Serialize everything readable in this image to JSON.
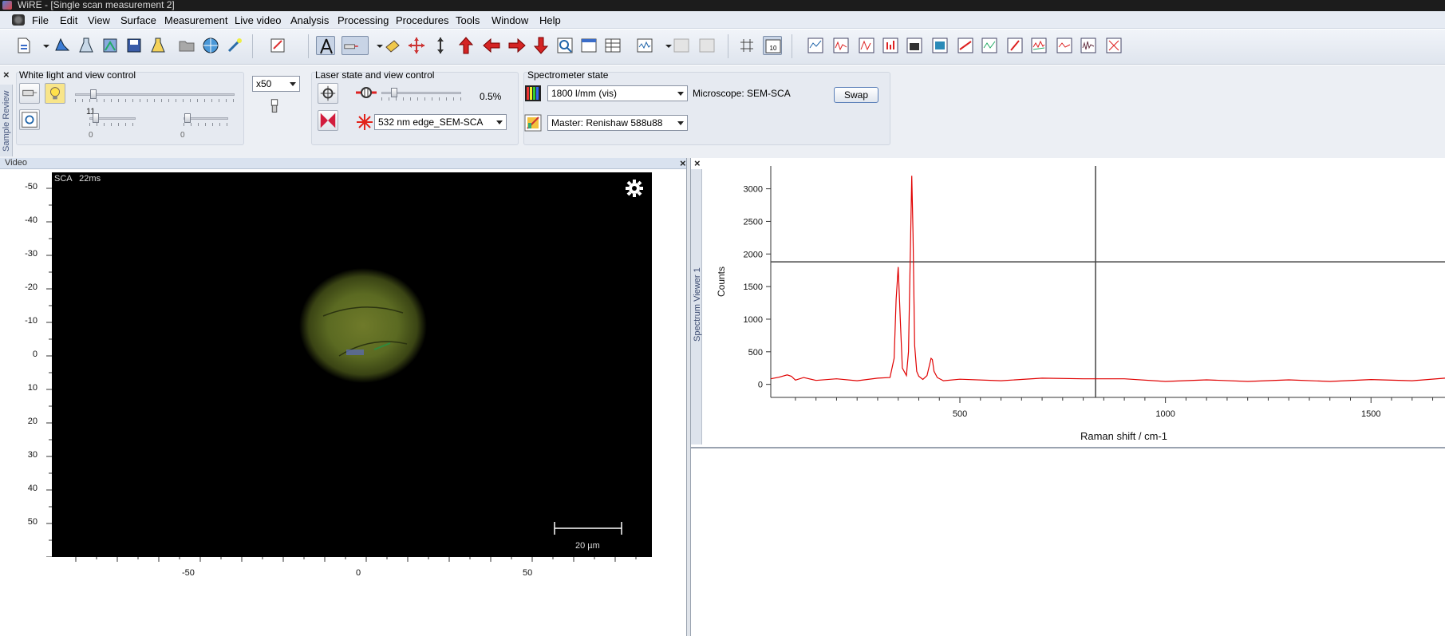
{
  "window": {
    "title": "WiRE - [Single scan measurement 2]"
  },
  "menu": [
    "File",
    "Edit",
    "View",
    "Surface",
    "Measurement",
    "Live video",
    "Analysis",
    "Processing",
    "Procedures",
    "Tools",
    "Window",
    "Help"
  ],
  "side_tabs": {
    "sample_review": "Sample Review",
    "spectrum_viewer": "Spectrum Viewer 1"
  },
  "white_light": {
    "title": "White light and view control",
    "slider_value": "11",
    "slider2_value": "0",
    "slider3_value": "0",
    "objective": "x50"
  },
  "laser": {
    "title": "Laser state and view control",
    "power": "0.5%",
    "laser_name": "532 nm edge_SEM-SCA"
  },
  "spectrometer": {
    "title": "Spectrometer state",
    "grating": "1800 l/mm (vis)",
    "microscope": "Microscope: SEM-SCA",
    "swap_label": "Swap",
    "master": "Master: Renishaw 588u88"
  },
  "video": {
    "panel_title": "Video",
    "overlay": "SCA   22ms",
    "scalebar": "20 µm",
    "y_ticks": [
      "-50",
      "-40",
      "-30",
      "-20",
      "-10",
      "0",
      "10",
      "20",
      "30",
      "40",
      "50"
    ],
    "x_ticks": [
      "-50",
      "0",
      "50"
    ]
  },
  "chart_data": {
    "type": "line",
    "title": "",
    "xlabel": "Raman shift / cm-1",
    "ylabel": "Counts",
    "xlim": [
      40,
      1680
    ],
    "ylim": [
      -200,
      3350
    ],
    "x_ticks": [
      500,
      1000,
      1500
    ],
    "y_ticks": [
      0,
      500,
      1000,
      1500,
      2000,
      2500,
      3000
    ],
    "cursor": {
      "x": 830,
      "y": 1880
    },
    "series": [
      {
        "color": "#e00000",
        "x": [
          40,
          60,
          80,
          90,
          100,
          120,
          150,
          200,
          250,
          300,
          330,
          340,
          345,
          350,
          355,
          360,
          370,
          375,
          380,
          383,
          386,
          390,
          395,
          400,
          410,
          420,
          430,
          433,
          437,
          445,
          460,
          500,
          600,
          700,
          800,
          900,
          1000,
          1100,
          1200,
          1300,
          1400,
          1500,
          1600,
          1680
        ],
        "y": [
          100,
          95,
          160,
          110,
          80,
          90,
          75,
          70,
          70,
          80,
          120,
          400,
          1300,
          1800,
          1000,
          250,
          150,
          500,
          2200,
          3200,
          2300,
          600,
          200,
          110,
          90,
          120,
          400,
          380,
          200,
          90,
          70,
          65,
          70,
          80,
          100,
          70,
          60,
          55,
          60,
          55,
          60,
          60,
          70,
          80
        ]
      }
    ]
  }
}
